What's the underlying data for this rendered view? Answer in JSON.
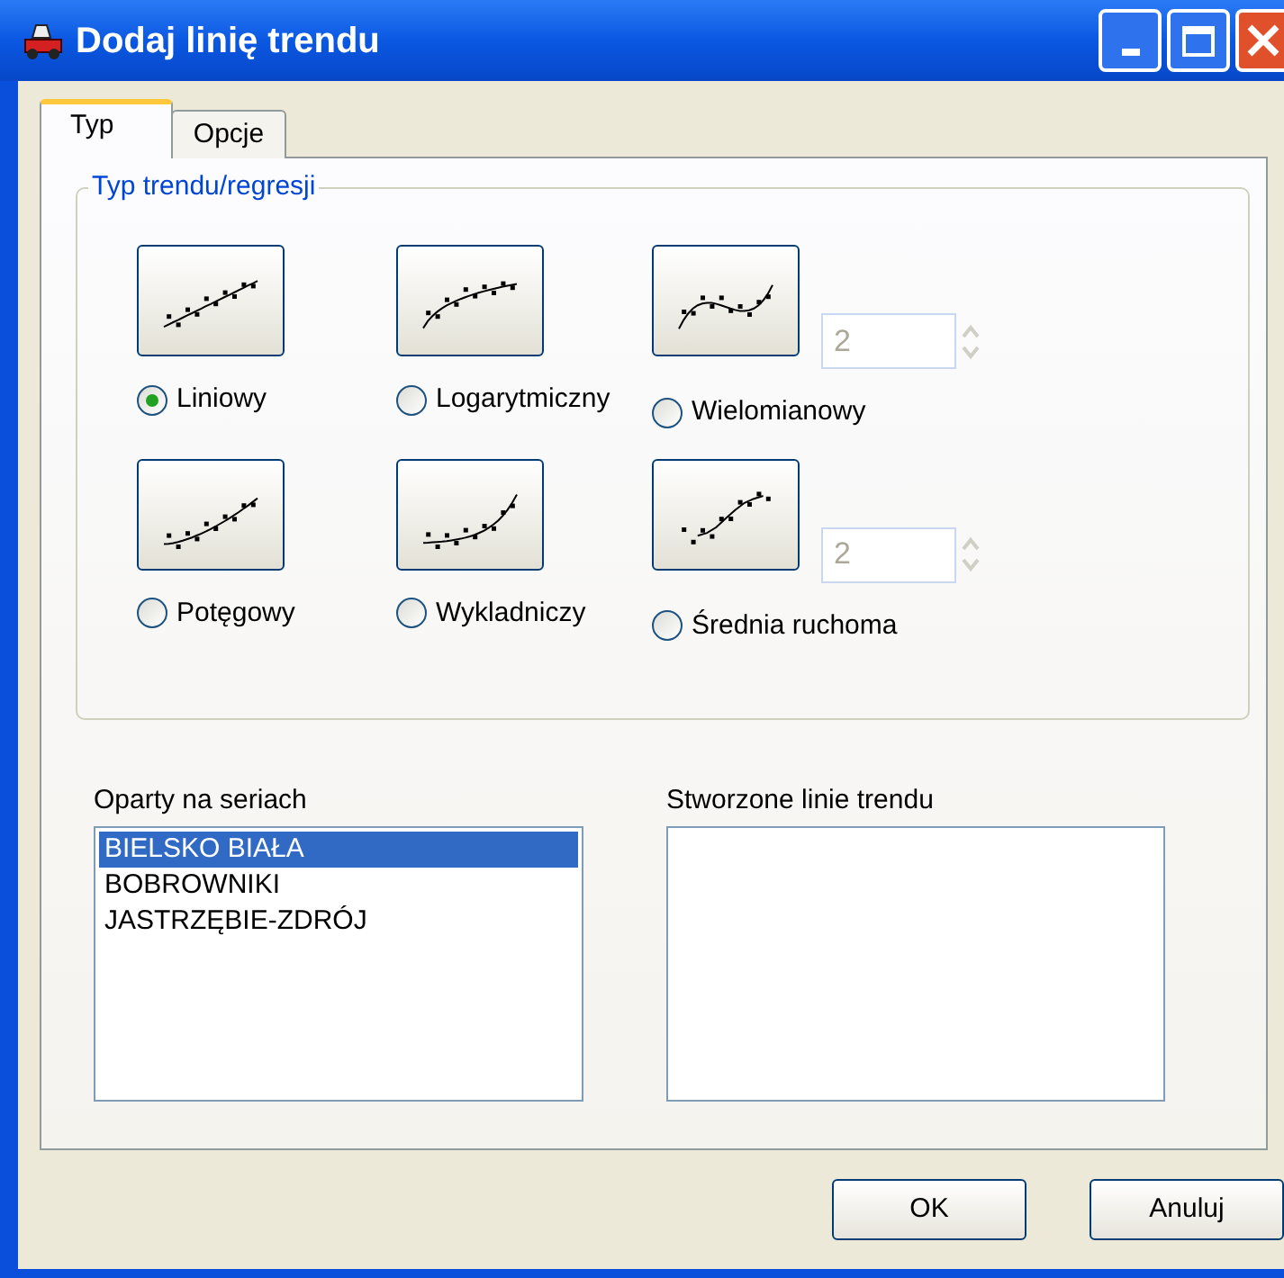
{
  "window": {
    "title": "Dodaj linię trendu"
  },
  "tabs": [
    {
      "label": "Typ",
      "selected": true
    },
    {
      "label": "Opcje",
      "selected": false
    }
  ],
  "trend_group": {
    "title": "Typ trendu/regresji",
    "types": [
      {
        "kind": "linear",
        "label": "Liniowy",
        "selected": true
      },
      {
        "kind": "logarithmic",
        "label": "Logarytmiczny",
        "selected": false
      },
      {
        "kind": "polynomial",
        "label": "Wielomianowy",
        "selected": false,
        "spin": {
          "value": "2",
          "disabled": true
        }
      },
      {
        "kind": "power",
        "label": "Potęgowy",
        "selected": false
      },
      {
        "kind": "exponential",
        "label": "Wykladniczy",
        "selected": false
      },
      {
        "kind": "moving_average",
        "label": "Średnia ruchoma",
        "selected": false,
        "spin": {
          "value": "2",
          "disabled": true
        }
      }
    ]
  },
  "series_list": {
    "label": "Oparty na seriach",
    "items": [
      {
        "label": "BIELSKO BIAŁA",
        "selected": true
      },
      {
        "label": "BOBROWNIKI",
        "selected": false
      },
      {
        "label": "JASTRZĘBIE-ZDRÓJ",
        "selected": false
      }
    ]
  },
  "trendlines_list": {
    "label": "Stworzone linie trendu"
  },
  "buttons": [
    {
      "label": "OK"
    },
    {
      "label": "Anuluj"
    }
  ]
}
